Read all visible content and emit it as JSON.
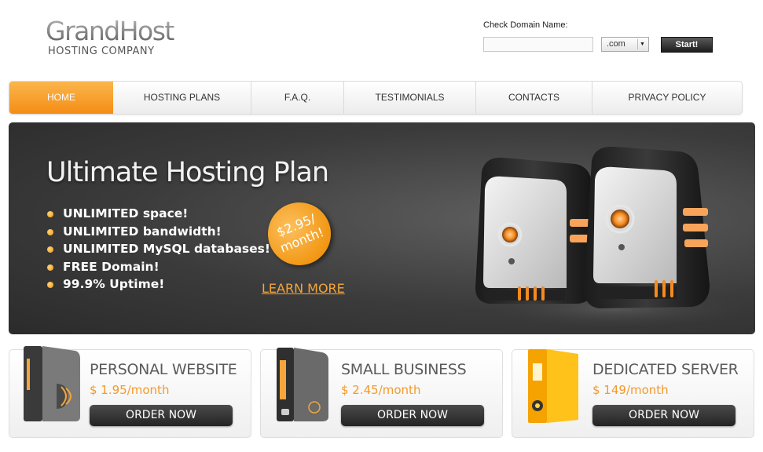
{
  "logo": {
    "name": "GrandHost",
    "tagline": "HOSTING COMPANY"
  },
  "domain_check": {
    "label": "Check Domain Name:",
    "input_value": "",
    "tld_selected": ".com",
    "button_label": "Start!"
  },
  "nav": {
    "items": [
      {
        "label": "HOME",
        "active": true
      },
      {
        "label": "HOSTING PLANS",
        "active": false
      },
      {
        "label": "F.A.Q.",
        "active": false
      },
      {
        "label": "TESTIMONIALS",
        "active": false
      },
      {
        "label": "CONTACTS",
        "active": false
      },
      {
        "label": "PRIVACY POLICY",
        "active": false
      }
    ],
    "active_color": "#f7a02f"
  },
  "hero": {
    "title": "Ultimate Hosting Plan",
    "features": [
      "UNLIMITED space!",
      "UNLIMITED bandwidth!",
      "UNLIMITED MySQL databases!",
      "FREE Domain!",
      "99.9% Uptime!"
    ],
    "price_line1": "$2.95/",
    "price_line2": "month!",
    "learn_more": "LEARN MORE",
    "accent_color": "#f5a53a"
  },
  "plans": [
    {
      "title": "PERSONAL WEBSITE",
      "price": "$ 1.95/month",
      "button": "ORDER NOW",
      "icon": "server-tower-icon"
    },
    {
      "title": "SMALL BUSINESS",
      "price": "$ 2.45/month",
      "button": "ORDER NOW",
      "icon": "server-tower-icon"
    },
    {
      "title": "DEDICATED SERVER",
      "price": "$ 149/month",
      "button": "ORDER NOW",
      "icon": "binder-folder-icon"
    }
  ]
}
